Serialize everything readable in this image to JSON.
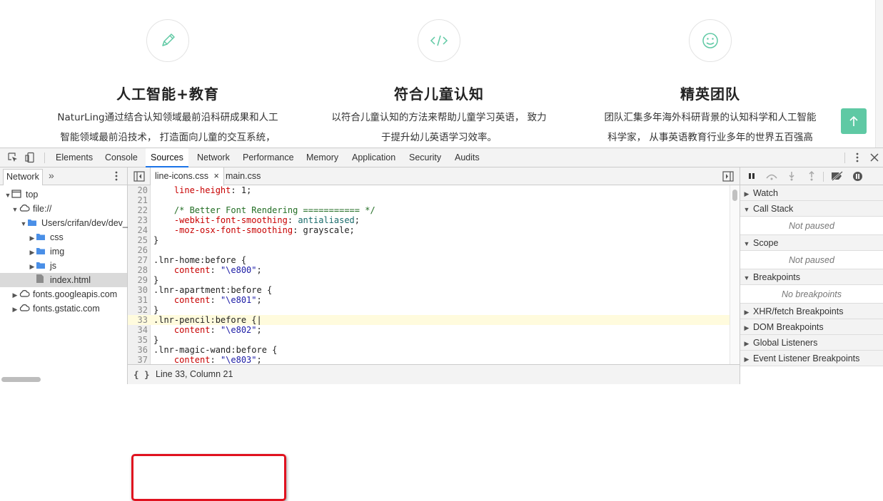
{
  "website": {
    "features": [
      {
        "title": "人工智能+教育",
        "line1": "NaturLing通过结合认知领域最前沿科研成果和人工",
        "line2": "智能领域最前沿技术， 打造面向儿童的交互系统，",
        "icon": "pencil-icon"
      },
      {
        "title": "符合儿童认知",
        "line1": "以符合儿童认知的方法来帮助儿童学习英语， 致力",
        "line2": "于提升幼儿英语学习效率。",
        "icon": "code-icon"
      },
      {
        "title": "精英团队",
        "line1": "团队汇集多年海外科研背景的认知科学和人工智能",
        "line2": "科学家， 从事英语教育行业多年的世界五百强高",
        "icon": "smiley-icon"
      }
    ],
    "accent_color": "#5fc9a4"
  },
  "devtools": {
    "tabs": [
      "Elements",
      "Console",
      "Sources",
      "Network",
      "Performance",
      "Memory",
      "Application",
      "Security",
      "Audits"
    ],
    "active_tab": "Sources",
    "navigator": {
      "tab": "Network",
      "more": "»",
      "tree": [
        {
          "label": "top",
          "type": "frame",
          "expanded": true
        },
        {
          "label": "file://",
          "type": "cloud",
          "expanded": true
        },
        {
          "label": "Users/crifan/dev/dev_",
          "type": "folder",
          "expanded": true
        },
        {
          "label": "css",
          "type": "folder",
          "expanded": false
        },
        {
          "label": "img",
          "type": "folder",
          "expanded": false
        },
        {
          "label": "js",
          "type": "folder",
          "expanded": false
        },
        {
          "label": "index.html",
          "type": "file",
          "selected": true
        },
        {
          "label": "fonts.googleapis.com",
          "type": "cloud",
          "expanded": false
        },
        {
          "label": "fonts.gstatic.com",
          "type": "cloud",
          "expanded": false
        }
      ]
    },
    "editor": {
      "files": [
        "line-icons.css",
        "main.css"
      ],
      "active_file": "line-icons.css",
      "status": "Line 33, Column 21",
      "format_label": "{ }",
      "lines": [
        {
          "n": "20",
          "html": "    <span class=\"prop\">line-height</span>: 1;"
        },
        {
          "n": "21",
          "html": ""
        },
        {
          "n": "22",
          "html": "    <span class=\"cmt\">/* Better Font Rendering =========== */</span>"
        },
        {
          "n": "23",
          "html": "    <span class=\"prop\">-webkit-font-smoothing</span>: <span class=\"val\">antialiased</span>;"
        },
        {
          "n": "24",
          "html": "    <span class=\"prop\">-moz-osx-font-smoothing</span>: grayscale;"
        },
        {
          "n": "25",
          "html": "}"
        },
        {
          "n": "26",
          "html": ""
        },
        {
          "n": "27",
          "html": ".lnr-home:before {"
        },
        {
          "n": "28",
          "html": "    <span class=\"prop\">content</span>: <span class=\"str\">\"\\e800\"</span>;"
        },
        {
          "n": "29",
          "html": "}"
        },
        {
          "n": "30",
          "html": ".lnr-apartment:before {"
        },
        {
          "n": "31",
          "html": "    <span class=\"prop\">content</span>: <span class=\"str\">\"\\e801\"</span>;"
        },
        {
          "n": "32",
          "html": "}"
        },
        {
          "n": "33",
          "html": ".lnr-pencil:before {|",
          "current": true
        },
        {
          "n": "34",
          "html": "    <span class=\"prop\">content</span>: <span class=\"str\">\"\\e802\"</span>;"
        },
        {
          "n": "35",
          "html": "}"
        },
        {
          "n": "36",
          "html": ".lnr-magic-wand:before {"
        },
        {
          "n": "37",
          "html": "    <span class=\"prop\">content</span>: <span class=\"str\">\"\\e803\"</span>;"
        }
      ]
    },
    "debugger": {
      "sections": [
        {
          "label": "Watch",
          "expanded": false
        },
        {
          "label": "Call Stack",
          "expanded": true,
          "info": "Not paused"
        },
        {
          "label": "Scope",
          "expanded": true,
          "info": "Not paused"
        },
        {
          "label": "Breakpoints",
          "expanded": true,
          "info": "No breakpoints"
        },
        {
          "label": "XHR/fetch Breakpoints",
          "expanded": false
        },
        {
          "label": "DOM Breakpoints",
          "expanded": false
        },
        {
          "label": "Global Listeners",
          "expanded": false
        },
        {
          "label": "Event Listener Breakpoints",
          "expanded": false
        }
      ]
    }
  }
}
